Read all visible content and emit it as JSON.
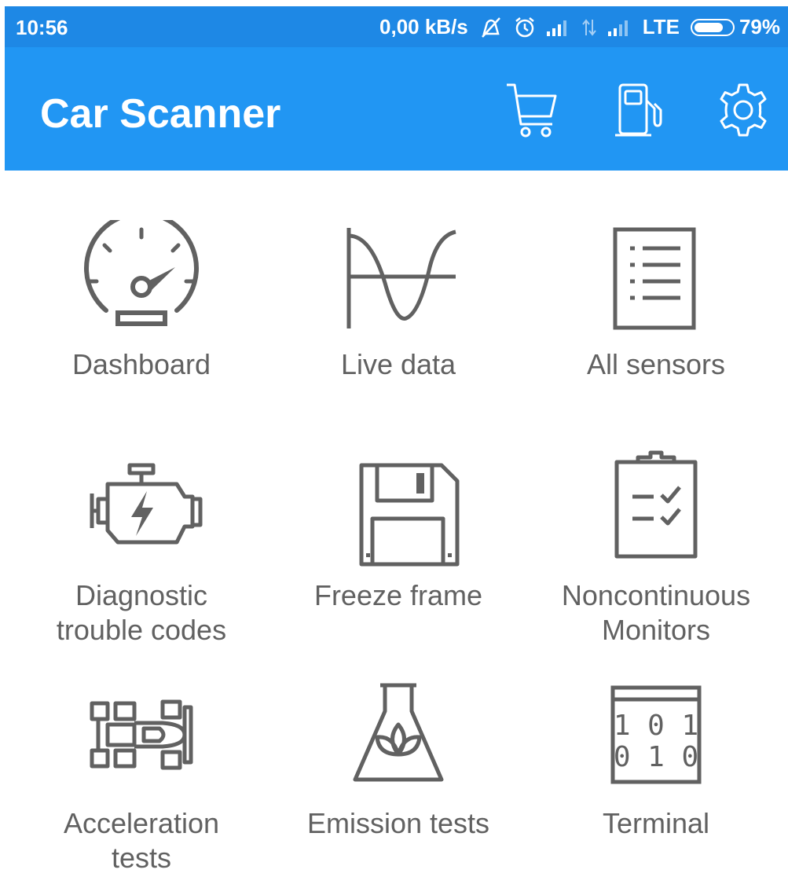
{
  "status_bar": {
    "time": "10:56",
    "speed": "0,00 kB/s",
    "network": "LTE",
    "battery_percent": "79%",
    "battery_level": 0.79,
    "icons": [
      "mute-icon",
      "alarm-icon",
      "signal-icon",
      "data-arrows-icon",
      "signal-icon-2"
    ]
  },
  "app_bar": {
    "title": "Car Scanner",
    "actions": [
      "cart-icon",
      "fuel-pump-icon",
      "gear-icon"
    ],
    "background": "#2196f3"
  },
  "menu": {
    "items": [
      {
        "label": "Dashboard",
        "icon": "speedometer-icon"
      },
      {
        "label": "Live data",
        "icon": "wave-graph-icon"
      },
      {
        "label": "All sensors",
        "icon": "list-document-icon"
      },
      {
        "label": "Diagnostic\ntrouble codes",
        "icon": "engine-icon"
      },
      {
        "label": "Freeze frame",
        "icon": "floppy-disk-icon"
      },
      {
        "label": "Noncontinuous\nMonitors",
        "icon": "clipboard-checklist-icon"
      },
      {
        "label": "Acceleration\ntests",
        "icon": "race-car-icon"
      },
      {
        "label": "Emission tests",
        "icon": "flask-leaf-icon"
      },
      {
        "label": "Terminal",
        "icon": "binary-terminal-icon"
      }
    ]
  },
  "colors": {
    "status_bar": "#1e88e5",
    "app_bar": "#2196f3",
    "icon_gray": "#616161",
    "label_gray": "#616161"
  }
}
